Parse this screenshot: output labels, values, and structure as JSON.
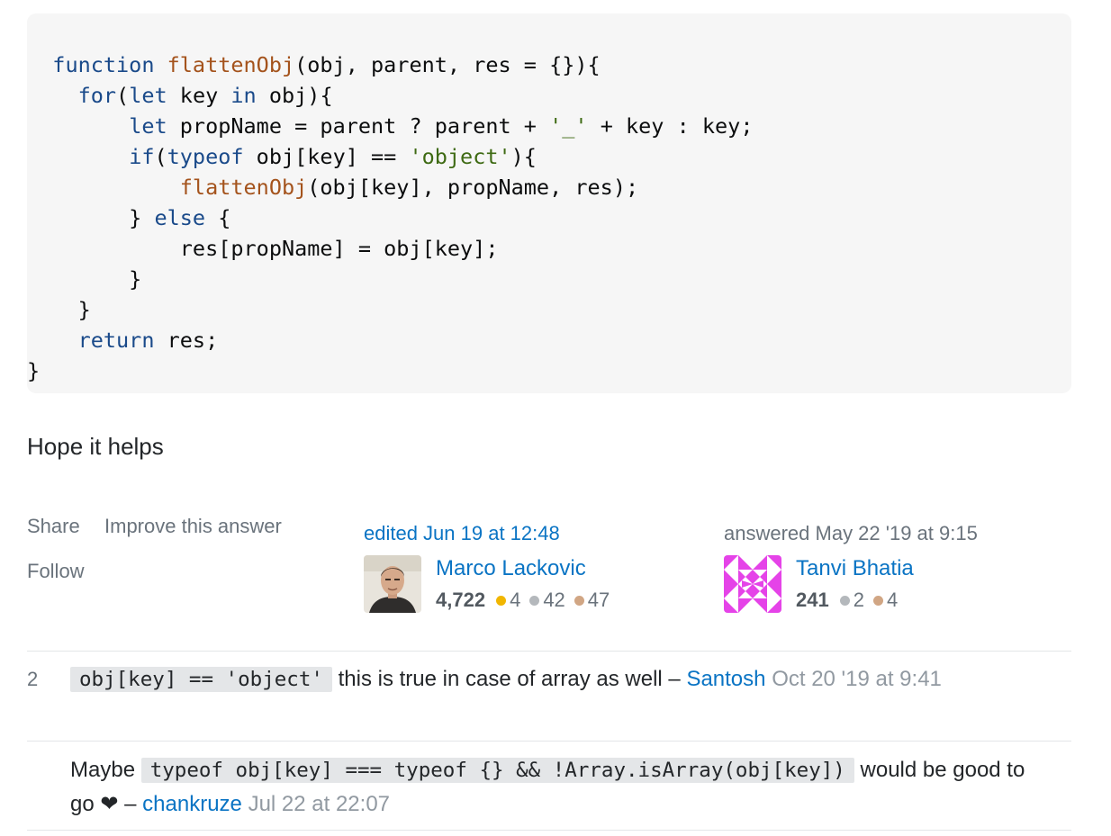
{
  "code": {
    "lines": [
      [
        {
          "t": "  "
        },
        {
          "t": "function",
          "c": "kw"
        },
        {
          "t": " "
        },
        {
          "t": "flattenObj",
          "c": "fn"
        },
        {
          "t": "(obj, parent, res = {}){"
        }
      ],
      [
        {
          "t": "    "
        },
        {
          "t": "for",
          "c": "kw"
        },
        {
          "t": "("
        },
        {
          "t": "let",
          "c": "kw"
        },
        {
          "t": " key "
        },
        {
          "t": "in",
          "c": "kw"
        },
        {
          "t": " obj){"
        }
      ],
      [
        {
          "t": "        "
        },
        {
          "t": "let",
          "c": "kw"
        },
        {
          "t": " propName = parent ? parent + "
        },
        {
          "t": "'_'",
          "c": "st"
        },
        {
          "t": " + key : key;"
        }
      ],
      [
        {
          "t": "        "
        },
        {
          "t": "if",
          "c": "kw"
        },
        {
          "t": "("
        },
        {
          "t": "typeof",
          "c": "kw"
        },
        {
          "t": " obj[key] == "
        },
        {
          "t": "'object'",
          "c": "st"
        },
        {
          "t": "){"
        }
      ],
      [
        {
          "t": "            "
        },
        {
          "t": "flattenObj",
          "c": "fn"
        },
        {
          "t": "(obj[key], propName, res);"
        }
      ],
      [
        {
          "t": "        } "
        },
        {
          "t": "else",
          "c": "kw"
        },
        {
          "t": " {"
        }
      ],
      [
        {
          "t": "            res[propName] = obj[key];"
        }
      ],
      [
        {
          "t": "        }"
        }
      ],
      [
        {
          "t": "    }"
        }
      ],
      [
        {
          "t": "    "
        },
        {
          "t": "return",
          "c": "kw"
        },
        {
          "t": " res;"
        }
      ],
      [
        {
          "t": "}"
        }
      ]
    ]
  },
  "answer": {
    "text": "Hope it helps"
  },
  "post_menu": {
    "share": "Share",
    "improve": "Improve this answer",
    "follow": "Follow"
  },
  "editor": {
    "action": "edited Jun 19 at 12:48",
    "name": "Marco Lackovic",
    "reputation": "4,722",
    "gold": "4",
    "silver": "42",
    "bronze": "47"
  },
  "author": {
    "action": "answered May 22 '19 at 9:15",
    "name": "Tanvi Bhatia",
    "reputation": "241",
    "silver": "2",
    "bronze": "4"
  },
  "comments": [
    {
      "score": "2",
      "code": "obj[key]  == 'object'",
      "text": " this is true in case of array as well – ",
      "user": "Santosh",
      "date": "Oct 20 '19 at 9:41"
    },
    {
      "score": "",
      "pre": "Maybe ",
      "code": "typeof obj[key] === typeof {} && !Array.isArray(obj[key])",
      "text": " would be good to go ❤ – ",
      "user": "chankruze",
      "date": "Jul 22 at 22:07"
    }
  ],
  "colors": {
    "link": "#0a74c4",
    "gold": "#f1b600",
    "silver": "#b4b8bc",
    "bronze": "#d1a684",
    "identicon": "#e543e8"
  }
}
